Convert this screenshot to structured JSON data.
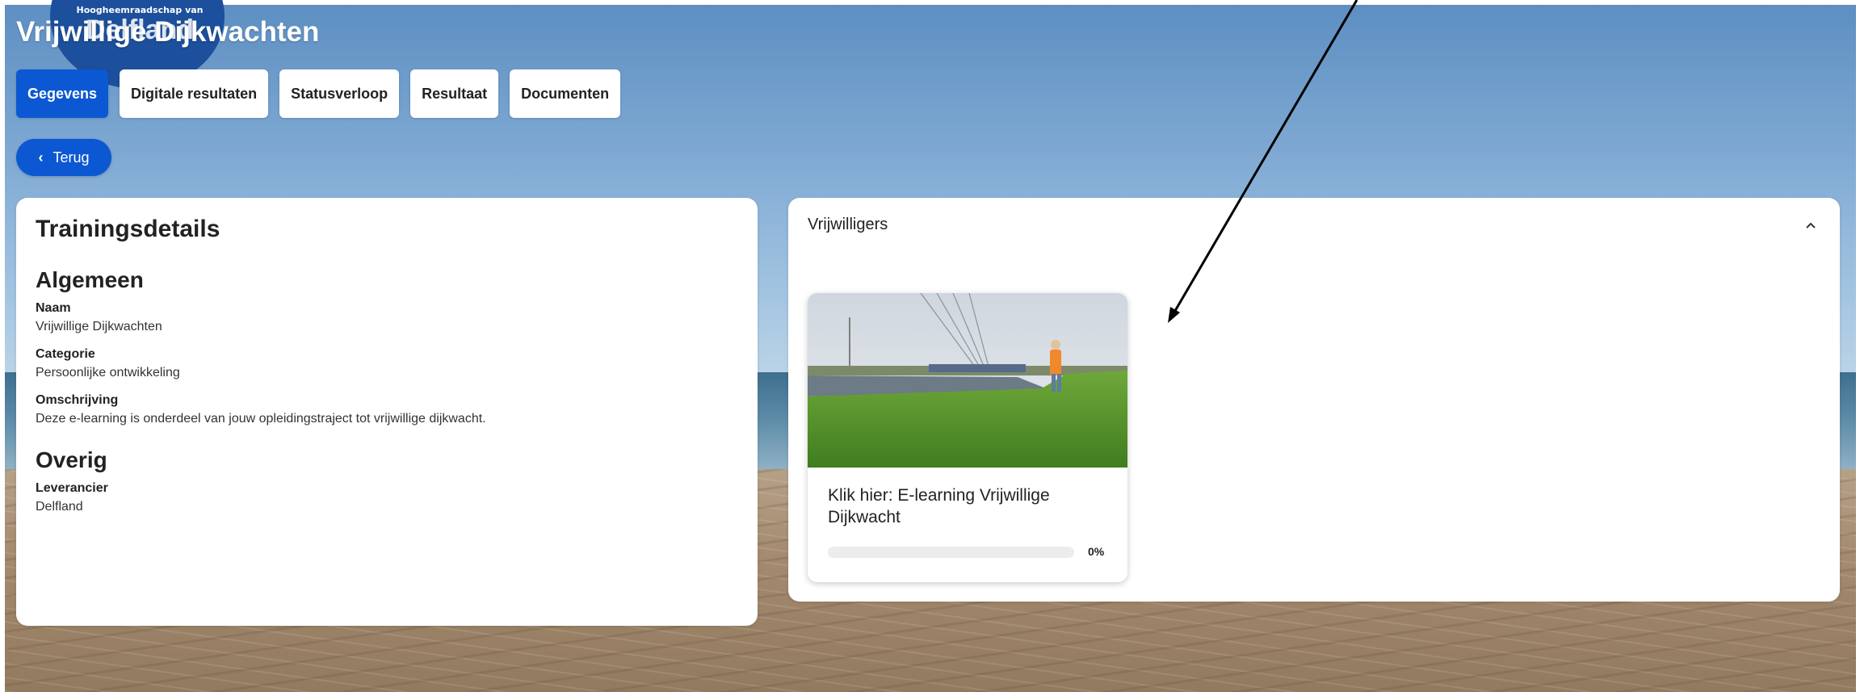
{
  "header": {
    "logo_small": "Hoogheemraadschap van",
    "logo_big": "Delfland",
    "title": "Vrijwillige Dijkwachten"
  },
  "tabs": [
    {
      "label": "Gegevens",
      "active": true
    },
    {
      "label": "Digitale resultaten",
      "active": false
    },
    {
      "label": "Statusverloop",
      "active": false
    },
    {
      "label": "Resultaat",
      "active": false
    },
    {
      "label": "Documenten",
      "active": false
    }
  ],
  "back_button": {
    "label": "Terug",
    "icon": "chevron-left-icon"
  },
  "training_details": {
    "title": "Trainingsdetails",
    "general": {
      "heading": "Algemeen",
      "fields": [
        {
          "label": "Naam",
          "value": "Vrijwillige Dijkwachten"
        },
        {
          "label": "Categorie",
          "value": "Persoonlijke ontwikkeling"
        },
        {
          "label": "Omschrijving",
          "value": "Deze e-learning is onderdeel van jouw opleidingstraject tot vrijwillige dijkwacht."
        }
      ]
    },
    "other": {
      "heading": "Overig",
      "fields": [
        {
          "label": "Leverancier",
          "value": "Delfland"
        }
      ]
    }
  },
  "volunteers": {
    "title": "Vrijwilligers",
    "collapse_icon": "chevron-up-icon",
    "course": {
      "title": "Klik hier: E-learning Vrijwillige Dijkwacht",
      "progress_label": "0%",
      "progress": 0
    }
  },
  "colors": {
    "accent": "#0b58d2",
    "logo_blue": "#1c4f9c",
    "card_bg": "#ffffff"
  }
}
